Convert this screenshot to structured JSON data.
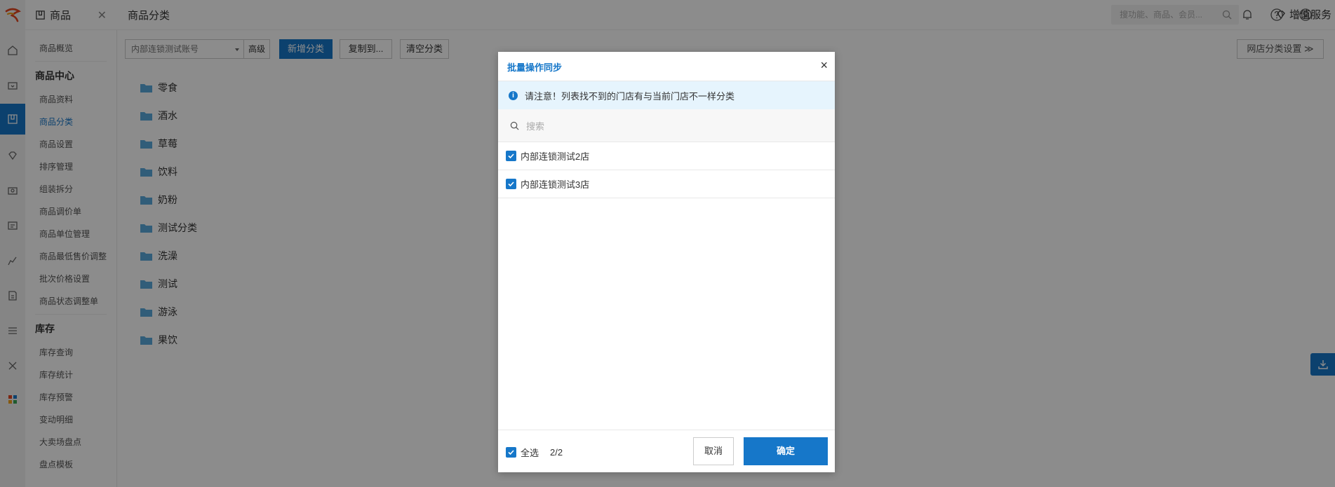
{
  "app": {
    "brand_color": "#1677c9",
    "module_title": "商品",
    "page_title": "商品分类"
  },
  "rail": {
    "icons": [
      "home-icon",
      "cashier-icon",
      "product-icon",
      "diamond-icon",
      "member-icon",
      "id-card-icon",
      "chart-icon",
      "report-icon",
      "settings-sliders-icon",
      "tools-icon",
      "apps-icon"
    ],
    "active_index": 2
  },
  "subnav": {
    "overview": "商品概览",
    "group1": "商品中心",
    "group1_items": [
      "商品资料",
      "商品分类",
      "商品设置",
      "排序管理",
      "组装拆分",
      "商品调价单",
      "商品单位管理",
      "商品最低售价调整",
      "批次价格设置",
      "商品状态调整单"
    ],
    "active_item": "商品分类",
    "group2": "库存",
    "group2_items": [
      "库存查询",
      "库存统计",
      "库存预警",
      "变动明细",
      "大卖场盘点",
      "盘点模板"
    ]
  },
  "topbar": {
    "search_placeholder": "搜功能、商品、会员...",
    "value_added": "增值服务"
  },
  "toolbar": {
    "account_select": "内部连锁测试账号",
    "advanced": "高级",
    "add_category": "新增分类",
    "copy_to": "复制到...",
    "clear_category": "清空分类",
    "online_settings": "网店分类设置 ≫"
  },
  "categories": [
    "零食",
    "酒水",
    "草莓",
    "饮料",
    "奶粉",
    "测试分类",
    "洗澡",
    "测试",
    "游泳",
    "果饮"
  ],
  "modal": {
    "title": "批量操作同步",
    "close": "×",
    "notice": "请注意！列表找不到的门店有与当前门店不一样分类",
    "search_placeholder": "搜索",
    "stores": [
      {
        "name": "内部连锁测试2店",
        "checked": true
      },
      {
        "name": "内部连锁测试3店",
        "checked": true
      }
    ],
    "select_all": "全选",
    "count": "2/2",
    "cancel": "取消",
    "confirm": "确定"
  }
}
